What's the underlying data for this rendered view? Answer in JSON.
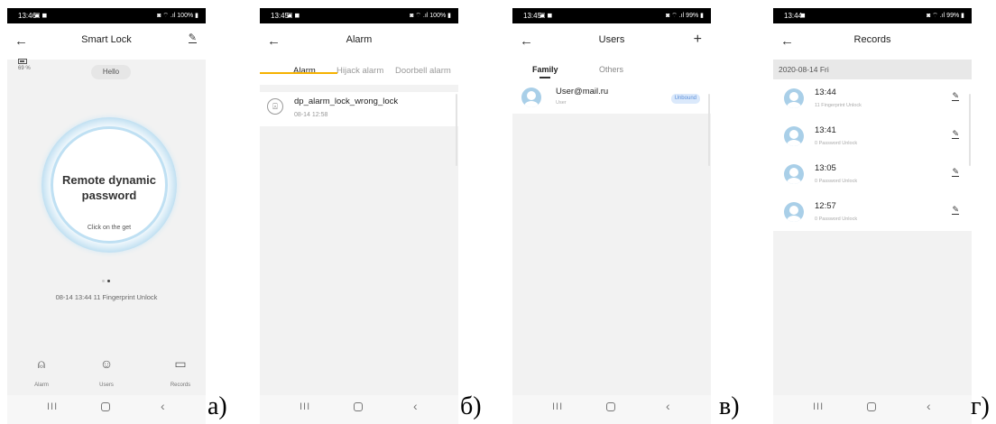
{
  "status_bars": {
    "a": {
      "time": "13:46",
      "icons": "▣ ◼",
      "right": "◙ ⌔ .ıl 100% ▮"
    },
    "b": {
      "time": "13:45",
      "icons": "▣ ◼",
      "right": "◙ ⌔ .ıl 100% ▮"
    },
    "c": {
      "time": "13:45",
      "icons": "▣ ◼",
      "right": "◙ ⌔ .ıl 99% ▮"
    },
    "d": {
      "time": "13:44",
      "icons": "◼",
      "right": "◙ ⌔ .ıl 99% ▮"
    }
  },
  "panel_a": {
    "title": "Smart Lock",
    "battery": "69 %",
    "greeting": "Hello",
    "remote_title": "Remote dynamic password",
    "remote_hint": "Click on the get",
    "last_record": "08-14 13:44  11 Fingerprint Unlock",
    "tabs": [
      {
        "icon": "alarm-icon",
        "label": "Alarm"
      },
      {
        "icon": "users-icon",
        "label": "Users"
      },
      {
        "icon": "calendar-icon",
        "label": "Records"
      }
    ],
    "caption": "а)"
  },
  "panel_b": {
    "title": "Alarm",
    "tabs": [
      "Alarm",
      "Hijack alarm",
      "Doorbell alarm"
    ],
    "item": {
      "title": "dp_alarm_lock_wrong_lock",
      "time": "08-14 12:58"
    },
    "caption": "б)"
  },
  "panel_c": {
    "title": "Users",
    "tabs": [
      "Family",
      "Others"
    ],
    "user": {
      "email": "User@mail.ru",
      "role": "User",
      "status": "Unbound"
    },
    "caption": "в)"
  },
  "panel_d": {
    "title": "Records",
    "date": "2020-08-14 Fri",
    "records": [
      {
        "time": "13:44",
        "desc": "11 Fingerprint Unlock"
      },
      {
        "time": "13:41",
        "desc": "0 Password Unlock"
      },
      {
        "time": "13:05",
        "desc": "0 Password Unlock"
      },
      {
        "time": "12:57",
        "desc": "0 Password Unlock"
      }
    ],
    "caption": "г)"
  },
  "nav": {
    "recent": "III",
    "back": "‹"
  },
  "colors": {
    "accent_yellow": "#f5b100",
    "ring_blue": "#bfe0f3",
    "avatar_blue": "#a9cfe8",
    "badge_blue": "#5b8fd9"
  }
}
